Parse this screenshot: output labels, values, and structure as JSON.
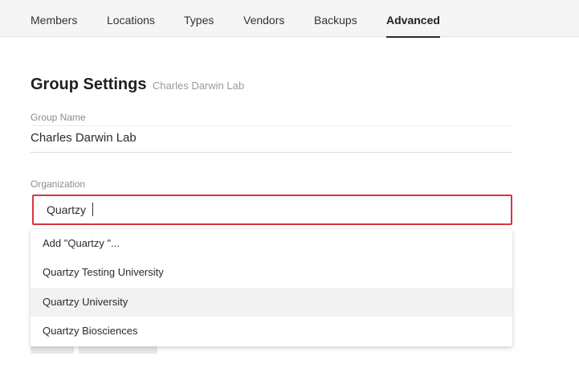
{
  "tabs": [
    {
      "label": "Members"
    },
    {
      "label": "Locations"
    },
    {
      "label": "Types"
    },
    {
      "label": "Vendors"
    },
    {
      "label": "Backups"
    },
    {
      "label": "Advanced",
      "active": true
    }
  ],
  "section": {
    "title": "Group Settings",
    "subtitle": "Charles Darwin Lab"
  },
  "group_name": {
    "label": "Group Name",
    "value": "Charles Darwin Lab"
  },
  "organization": {
    "label": "Organization",
    "value": "Quartzy "
  },
  "dropdown": {
    "options": [
      {
        "label": "Add \"Quartzy \"..."
      },
      {
        "label": "Quartzy Testing University"
      },
      {
        "label": "Quartzy University",
        "highlighted": true
      },
      {
        "label": "Quartzy Biosciences"
      }
    ]
  },
  "colors": {
    "focus_border": "#d9363e",
    "tab_bar": "#f5f5f5",
    "highlight": "#f2f2f2"
  }
}
